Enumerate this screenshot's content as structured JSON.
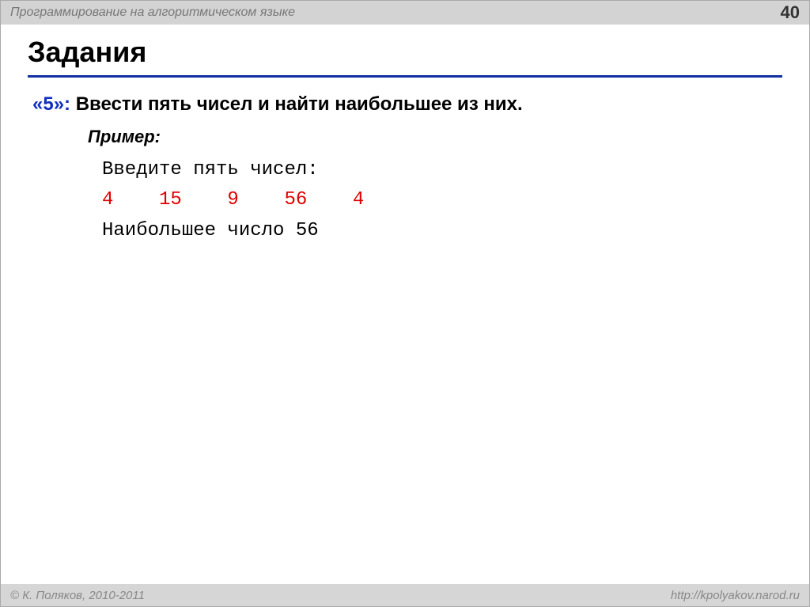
{
  "header": {
    "title": "Программирование на алгоритмическом языке",
    "slideNumber": "40"
  },
  "mainTitle": "Задания",
  "task": {
    "rating": "«5»:",
    "text": " Ввести пять чисел и найти наибольшее из них."
  },
  "example": {
    "label": "Пример:",
    "prompt": "Введите пять чисел:",
    "input": "4    15    9    56    4",
    "result": "Наибольшее число 56"
  },
  "footer": {
    "left": "© К. Поляков, 2010-2011",
    "right": "http://kpolyakov.narod.ru"
  }
}
